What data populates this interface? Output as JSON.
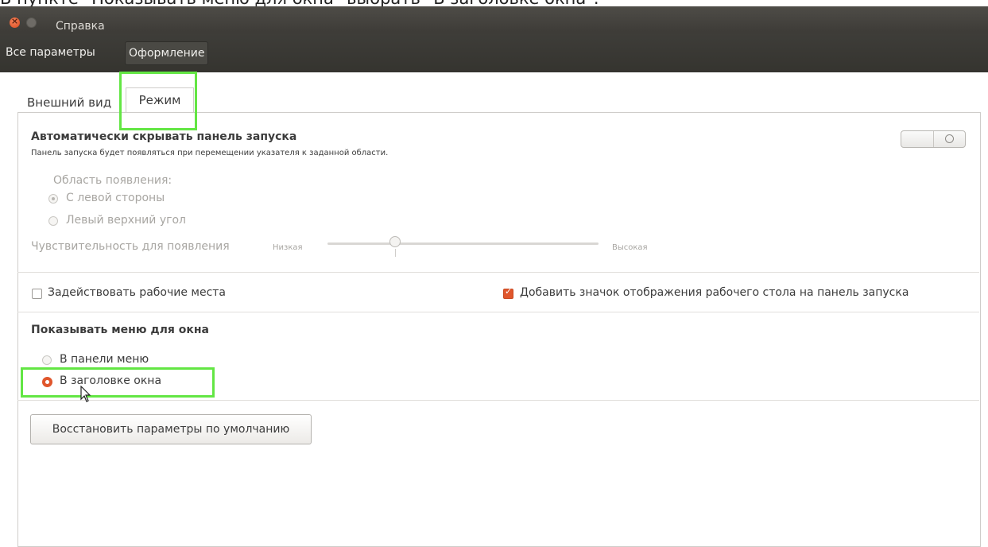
{
  "caption": "В пункте \"Показывать меню для окна\" выбрать \"В заголовке окна\".",
  "window": {
    "title": "Справка"
  },
  "menubar": {
    "all_settings": "Все параметры",
    "appearance": "Оформление"
  },
  "tabs": [
    {
      "label": "Внешний вид",
      "active": false
    },
    {
      "label": "Режим",
      "active": true
    }
  ],
  "autohide": {
    "title": "Автоматически скрывать панель запуска",
    "description": "Панель запуска будет появляться при перемещении указателя к заданной области.",
    "enabled": false,
    "reveal_area_label": "Область появления:",
    "options": [
      {
        "label": "С левой стороны",
        "selected": true
      },
      {
        "label": "Левый верхний угол",
        "selected": false
      }
    ],
    "sensitivity": {
      "label": "Чувствительность для появления",
      "low": "Низкая",
      "high": "Высокая",
      "value": 0.25
    }
  },
  "workspaces": {
    "label": "Задействовать рабочие места",
    "checked": false
  },
  "show_desktop": {
    "label": "Добавить значок отображения рабочего стола на панель запуска",
    "checked": true
  },
  "window_menu": {
    "title": "Показывать меню для окна",
    "options": [
      {
        "label": "В панели меню",
        "selected": false
      },
      {
        "label": "В заголовке окна",
        "selected": true
      }
    ]
  },
  "reset_button": "Восстановить параметры по умолчанию",
  "colors": {
    "accent": "#e0562c",
    "highlight": "#63e644",
    "titlebar": "#3d3b37"
  }
}
